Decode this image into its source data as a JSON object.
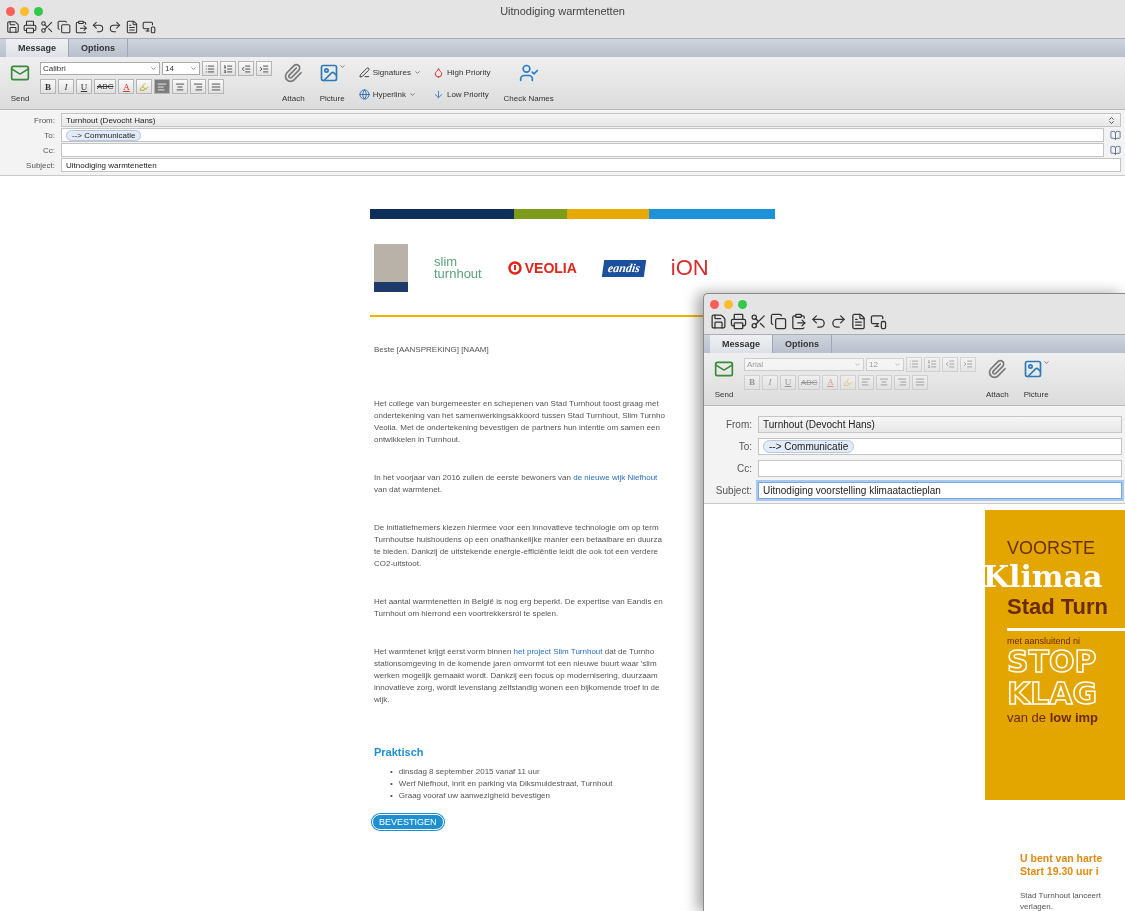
{
  "main_window": {
    "title": "Uitnodiging warmtenetten",
    "tabs": [
      {
        "label": "Message",
        "selected": true
      },
      {
        "label": "Options",
        "selected": false
      }
    ],
    "ribbon": {
      "groups": [
        {
          "kind": "send",
          "label": "Send"
        },
        {
          "kind": "format",
          "font": "Calibri",
          "size": "14",
          "disabled": false,
          "styles": [
            "B",
            "I",
            "U",
            "ABC"
          ],
          "color_label": "A",
          "align": [
            {
              "selected": true
            },
            {
              "selected": false
            },
            {
              "selected": false
            },
            {
              "selected": false
            }
          ]
        },
        {
          "kind": "attach",
          "label": "Attach"
        },
        {
          "kind": "picture",
          "label": "Picture"
        },
        {
          "kind": "column",
          "items": [
            {
              "kind": "signatures",
              "label": "Signatures"
            },
            {
              "kind": "hyperlink",
              "label": "Hyperlink"
            }
          ]
        },
        {
          "kind": "column",
          "items": [
            {
              "kind": "high",
              "label": "High Priority"
            },
            {
              "kind": "low",
              "label": "Low Priority"
            }
          ]
        },
        {
          "kind": "names",
          "label": "Check Names"
        }
      ]
    },
    "header": {
      "from_label": "From:",
      "from": "Turnhout (Devocht Hans)",
      "to_label": "To:",
      "to": [
        "--> Communicatie"
      ],
      "cc_label": "Cc:",
      "subject_label": "Subject:",
      "subject": {
        "value": "Uitnodiging warmtenetten",
        "focused": false
      }
    },
    "message": {
      "banner": [
        {
          "color": "#0e2f5a"
        },
        {
          "color": "#7e9c1c"
        },
        {
          "color": "#e8aa00"
        },
        {
          "color": "#1c93d8"
        }
      ],
      "logos": [
        {
          "kind": "city"
        },
        {
          "kind": "slim",
          "lines": [
            "slim",
            "turnhout"
          ]
        },
        {
          "kind": "veolia",
          "text": "VEOLIA"
        },
        {
          "kind": "eandis",
          "text": "eandis"
        },
        {
          "kind": "ion",
          "text": "iON"
        }
      ],
      "greeting": "Beste [AANSPREKING] [NAAM]",
      "paragraphs": [
        {
          "lines": [
            [
              {
                "text": "Het college van burgemeester en schepenen van Stad Turnhout toost graag met",
                "link": false
              }
            ],
            [
              {
                "text": "ondertekening van het samenwerkingsakkoord tussen Stad Turnhout, Slim Turnho",
                "link": false
              }
            ],
            [
              {
                "text": "Veolia. Met de ondertekening bevestigen de partners hun intentie om samen een",
                "link": false
              }
            ],
            [
              {
                "text": "ontwikkelen in Turnhout.",
                "link": false
              }
            ]
          ]
        },
        {
          "lines": [
            [
              {
                "text": "In het voorjaar van 2016 zullen de eerste bewoners van ",
                "link": false
              },
              {
                "text": "de nieuwe wijk Niefhout",
                "link": true
              }
            ],
            [
              {
                "text": "van dat warmtenet.",
                "link": false
              }
            ]
          ]
        },
        {
          "lines": [
            [
              {
                "text": "De initiatiefnemers kiezen hiermee voor een innovatieve technologie om op term",
                "link": false
              }
            ],
            [
              {
                "text": "Turnhoutse huishoudens op een onafhankelijke manier een betaalbare en duurza",
                "link": false
              }
            ],
            [
              {
                "text": "te bieden. Dankzij de uitstekende energie-efficiëntie leidt die ook tot een verdere",
                "link": false
              }
            ],
            [
              {
                "text": "CO2-uitstoot.",
                "link": false
              }
            ]
          ]
        },
        {
          "lines": [
            [
              {
                "text": "Het aantal warmtenetten in België is nog erg beperkt. De expertise van Eandis en",
                "link": false
              }
            ],
            [
              {
                "text": "Turnhout om hierrond een voortrekkersrol te spelen.",
                "link": false
              }
            ]
          ]
        },
        {
          "lines": [
            [
              {
                "text": "Het warmtenet krijgt eerst vorm binnen ",
                "link": false
              },
              {
                "text": "het project Slim Turnhout",
                "link": true
              },
              {
                "text": " dat de Turnho",
                "link": false
              }
            ],
            [
              {
                "text": "stationsomgeving in de komende jaren omvormt tot een nieuwe buurt waar 'slim",
                "link": false
              }
            ],
            [
              {
                "text": "werken mogelijk gemaakt wordt. Dankzij een focus op modernisering, duurzaam",
                "link": false
              }
            ],
            [
              {
                "text": "innovatieve zorg, wordt levenslang zelfstandig wonen een bijkomende troef in de",
                "link": false
              }
            ],
            [
              {
                "text": "wijk.",
                "link": false
              }
            ]
          ]
        }
      ],
      "section_title": "Praktisch",
      "bullets": [
        {
          "marker": "•",
          "text": "dinsdag 8 september 2015 vanaf 11 uur"
        },
        {
          "marker": "•",
          "text": "Werf Niefhout, inrit en parking via Diksmuidestraat, Turnhout"
        },
        {
          "marker": "•",
          "text": "Graag vooraf uw aanwezigheid bevestigen"
        }
      ],
      "button": "BEVESTIGEN"
    }
  },
  "front_window": {
    "tabs": [
      {
        "label": "Message",
        "selected": true
      },
      {
        "label": "Options",
        "selected": false
      }
    ],
    "ribbon": {
      "groups": [
        {
          "kind": "send",
          "label": "Send"
        },
        {
          "kind": "format",
          "font": "Arial",
          "size": "12",
          "disabled": true,
          "styles": [
            "B",
            "I",
            "U",
            "ABC"
          ],
          "color_label": "A",
          "align": [
            {
              "selected": false
            },
            {
              "selected": false
            },
            {
              "selected": false
            },
            {
              "selected": false
            }
          ]
        },
        {
          "kind": "attach",
          "label": "Attach"
        },
        {
          "kind": "picture",
          "label": "Picture"
        }
      ]
    },
    "header": {
      "from_label": "From:",
      "from": "Turnhout (Devocht Hans)",
      "to_label": "To:",
      "to": [
        "--> Communicatie"
      ],
      "cc_label": "Cc:",
      "subject_label": "Subject:",
      "subject": {
        "value": "Uitnodiging voorstelling klimaatactieplan",
        "focused": true
      }
    },
    "poster": {
      "kicker": "VOORSTE",
      "title": "Klimaa",
      "subtitle": "Stad Turn",
      "note": "met aansluitend ni",
      "slogan": [
        "STOP",
        "KLAG"
      ],
      "footer": "van de **low imp**"
    },
    "heading": [
      "U bent van harte",
      "Start 19.30 uur i"
    ],
    "paragraph": [
      "Stad Turnhout lanceert",
      "verlagen."
    ]
  }
}
